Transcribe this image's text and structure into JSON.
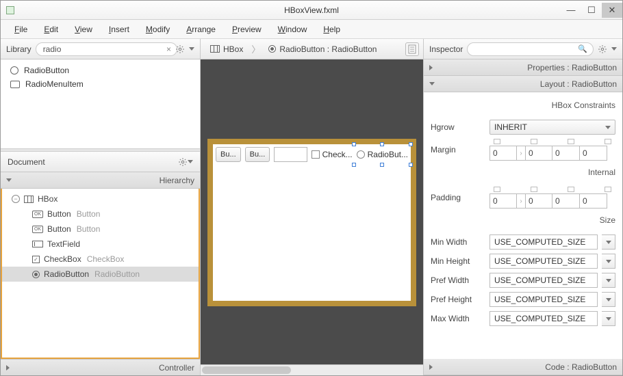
{
  "window": {
    "title": "HBoxView.fxml"
  },
  "menu": [
    "File",
    "Edit",
    "View",
    "Insert",
    "Modify",
    "Arrange",
    "Preview",
    "Window",
    "Help"
  ],
  "library": {
    "title": "Library",
    "search": "radio",
    "items": [
      {
        "icon": "radio",
        "label": "RadioButton"
      },
      {
        "icon": "radiomenu",
        "label": "RadioMenuItem"
      }
    ]
  },
  "document": {
    "title": "Document",
    "hierarchy_title": "Hierarchy",
    "controller_title": "Controller",
    "tree": [
      {
        "depth": 1,
        "icon": "hbox",
        "type": "HBox",
        "text": "",
        "expander": true
      },
      {
        "depth": 2,
        "icon": "btn",
        "type": "Button",
        "text": "Button"
      },
      {
        "depth": 2,
        "icon": "btn",
        "type": "Button",
        "text": "Button"
      },
      {
        "depth": 2,
        "icon": "tf",
        "type": "TextField",
        "text": ""
      },
      {
        "depth": 2,
        "icon": "cb",
        "type": "CheckBox",
        "text": "CheckBox"
      },
      {
        "depth": 2,
        "icon": "rb",
        "type": "RadioButton",
        "text": "RadioButton",
        "selected": true
      }
    ]
  },
  "breadcrumb": [
    {
      "icon": "hbox",
      "label": "HBox"
    },
    {
      "icon": "rb",
      "label": "RadioButton : RadioButton"
    }
  ],
  "canvas": {
    "buttons": [
      "Bu...",
      "Bu..."
    ],
    "checkbox": "Check...",
    "radio": "RadioBut..."
  },
  "inspector": {
    "title": "Inspector",
    "properties_title": "Properties : RadioButton",
    "layout_title": "Layout : RadioButton",
    "code_title": "Code : RadioButton",
    "groups": {
      "hbox": "HBox Constraints",
      "internal": "Internal",
      "size": "Size"
    },
    "hgrow": {
      "label": "Hgrow",
      "value": "INHERIT"
    },
    "margin": {
      "label": "Margin",
      "values": [
        "0",
        "0",
        "0",
        "0"
      ]
    },
    "padding": {
      "label": "Padding",
      "values": [
        "0",
        "0",
        "0",
        "0"
      ]
    },
    "sizes": [
      {
        "label": "Min Width",
        "value": "USE_COMPUTED_SIZE"
      },
      {
        "label": "Min Height",
        "value": "USE_COMPUTED_SIZE"
      },
      {
        "label": "Pref Width",
        "value": "USE_COMPUTED_SIZE"
      },
      {
        "label": "Pref Height",
        "value": "USE_COMPUTED_SIZE"
      },
      {
        "label": "Max Width",
        "value": "USE_COMPUTED_SIZE"
      }
    ]
  }
}
